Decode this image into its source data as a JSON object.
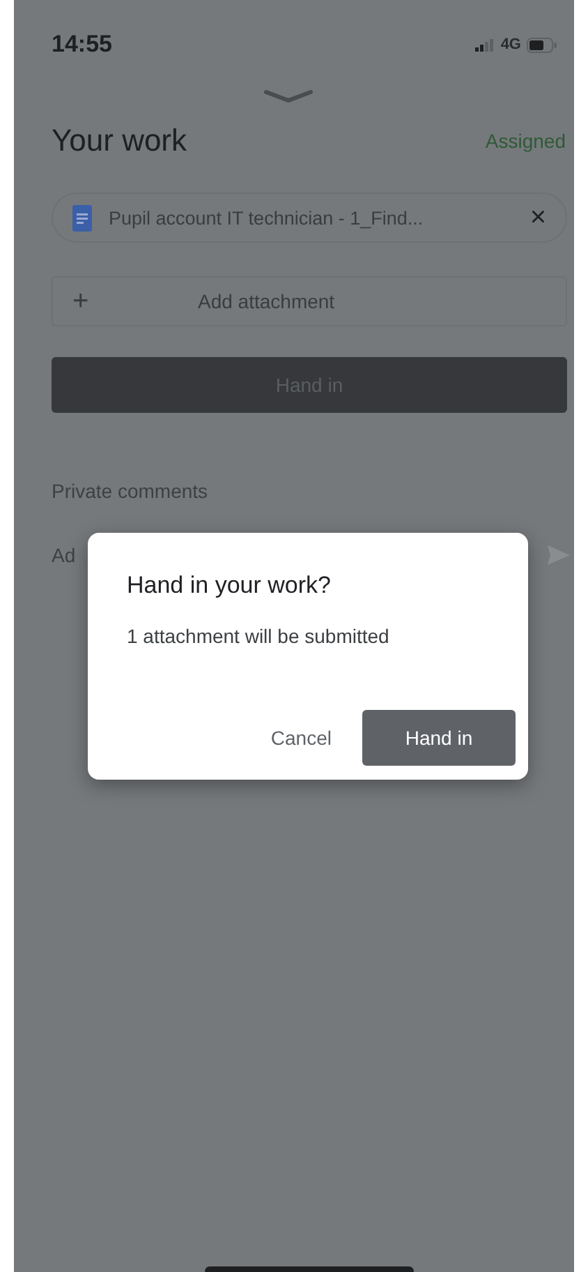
{
  "status_bar": {
    "time": "14:55",
    "network": "4G"
  },
  "header": {
    "title": "Your work",
    "status": "Assigned"
  },
  "attachment": {
    "name": "Pupil account IT technician - 1_Find...",
    "remove": "×"
  },
  "add_attachment": {
    "icon": "+",
    "label": "Add attachment"
  },
  "hand_in_button": "Hand in",
  "private_comments": {
    "title": "Private comments",
    "placeholder": "Ad"
  },
  "dialog": {
    "title": "Hand in your work?",
    "message": "1 attachment will be submitted",
    "buttons": [
      {
        "label": "Cancel",
        "kind": "text"
      },
      {
        "label": "Hand in",
        "kind": "filled"
      }
    ]
  }
}
